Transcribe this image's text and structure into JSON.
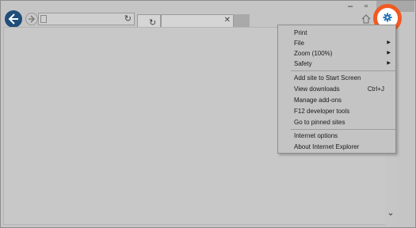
{
  "menu": {
    "print": "Print",
    "file": "File",
    "zoom": "Zoom (100%)",
    "safety": "Safety",
    "add_site": "Add site to Start Screen",
    "view_downloads": "View downloads",
    "view_downloads_shortcut": "Ctrl+J",
    "manage_addons": "Manage add-ons",
    "dev_tools": "F12 developer tools",
    "pinned_sites": "Go to pinned sites",
    "internet_options": "Internet options",
    "about": "About Internet Explorer"
  },
  "colors": {
    "highlight": "#f15a22",
    "back_button": "#1f4e79",
    "gear": "#1f6fb2"
  }
}
